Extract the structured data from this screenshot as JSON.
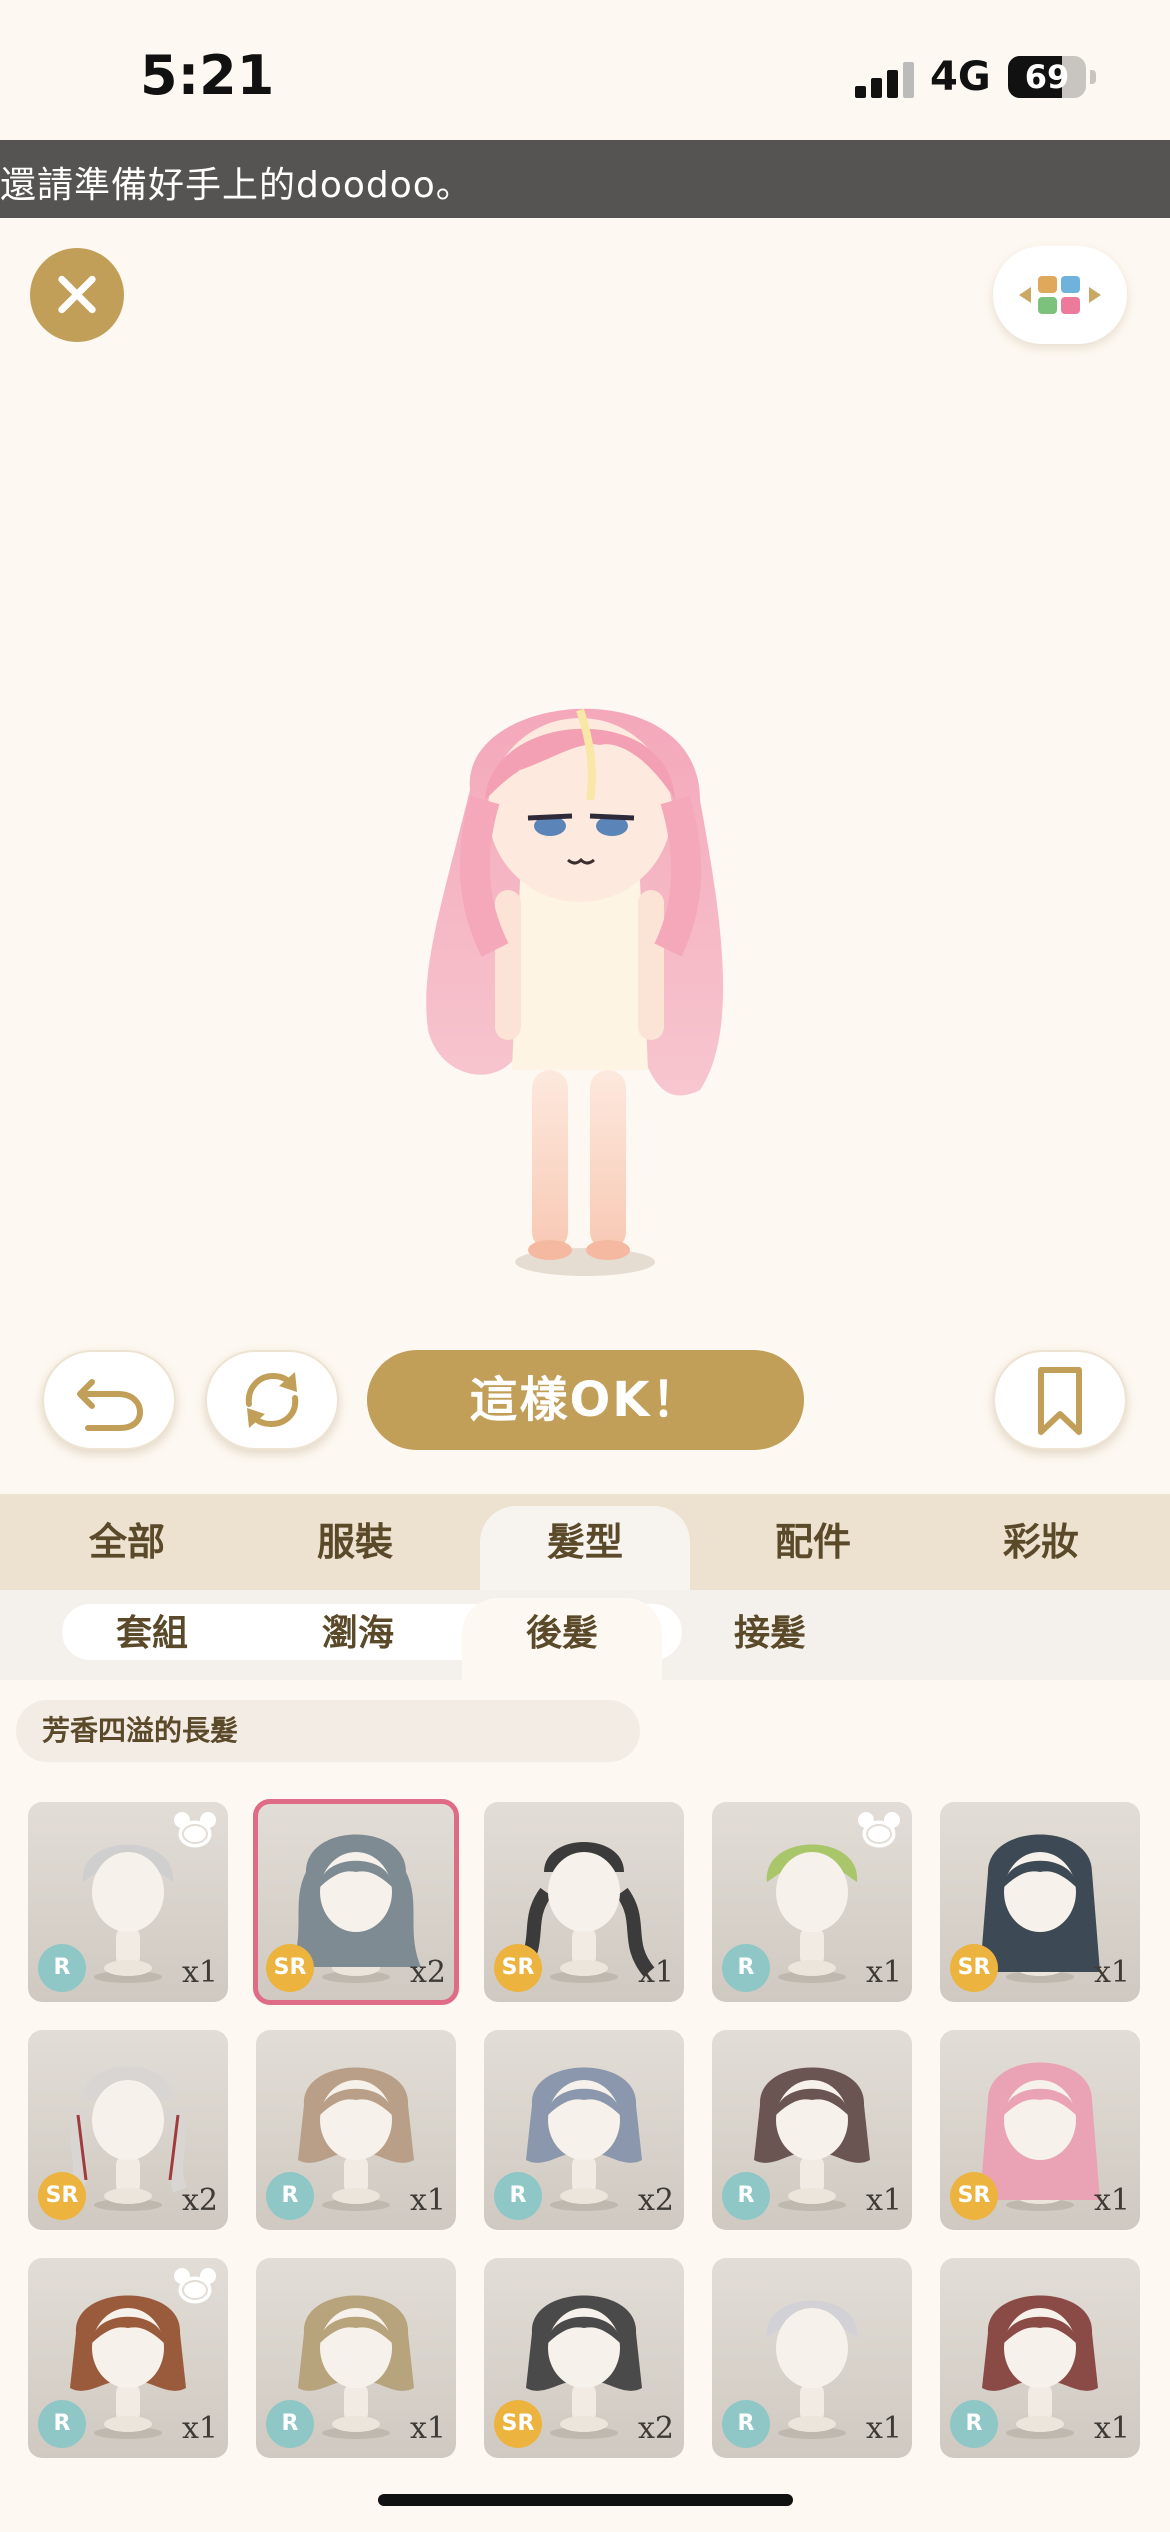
{
  "status_bar": {
    "time": "5:21",
    "network": "4G",
    "battery": "69",
    "battery_level": 0.69
  },
  "marquee": {
    "text": "還請準備好手上的doodoo。"
  },
  "colors": {
    "accent": "#c19f59",
    "selected_outline": "#e06b86",
    "rarity_r": "#8fc7c6",
    "rarity_sr": "#ecb33f"
  },
  "actions": {
    "ok_label": "這樣OK！"
  },
  "main_tabs": [
    "全部",
    "服裝",
    "髮型",
    "配件",
    "彩妝"
  ],
  "main_tab_active": "髮型",
  "sub_tabs": [
    "套組",
    "瀏海",
    "後髮",
    "接髮"
  ],
  "sub_tab_active": "後髮",
  "selected_item_name": "芳香四溢的長髮",
  "items": [
    {
      "rarity": "R",
      "count": "x1",
      "bear": true,
      "color": "#cfcfcf",
      "style": "short"
    },
    {
      "rarity": "SR",
      "count": "x2",
      "bear": false,
      "color": "#7f8b93",
      "style": "wavy",
      "selected": true
    },
    {
      "rarity": "SR",
      "count": "x1",
      "bear": false,
      "color": "#3b3b3b",
      "style": "twin"
    },
    {
      "rarity": "R",
      "count": "x1",
      "bear": true,
      "color": "#a9c66a",
      "style": "short"
    },
    {
      "rarity": "SR",
      "count": "x1",
      "bear": false,
      "color": "#3d4a55",
      "style": "long"
    },
    {
      "rarity": "SR",
      "count": "x2",
      "bear": false,
      "color": "#d9d5d3",
      "style": "braids"
    },
    {
      "rarity": "R",
      "count": "x1",
      "bear": false,
      "color": "#b99f87",
      "style": "bob"
    },
    {
      "rarity": "R",
      "count": "x2",
      "bear": false,
      "color": "#8b97ad",
      "style": "bob"
    },
    {
      "rarity": "R",
      "count": "x1",
      "bear": false,
      "color": "#6a5552",
      "style": "bob"
    },
    {
      "rarity": "SR",
      "count": "x1",
      "bear": false,
      "color": "#e9a3b5",
      "style": "long"
    },
    {
      "rarity": "R",
      "count": "x1",
      "bear": true,
      "color": "#9a5a3c",
      "style": "bob"
    },
    {
      "rarity": "R",
      "count": "x1",
      "bear": false,
      "color": "#b7a37c",
      "style": "bob"
    },
    {
      "rarity": "SR",
      "count": "x2",
      "bear": false,
      "color": "#4a4a4a",
      "style": "bob"
    },
    {
      "rarity": "R",
      "count": "x1",
      "bear": false,
      "color": "#d2d2d6",
      "style": "short"
    },
    {
      "rarity": "R",
      "count": "x1",
      "bear": false,
      "color": "#8a4a45",
      "style": "bob"
    }
  ],
  "icons": {
    "close": "close-icon",
    "layout": "color-grid-icon",
    "undo": "undo-icon",
    "rotate": "rotate-icon",
    "bookmark": "bookmark-icon",
    "bear": "bear-icon"
  }
}
